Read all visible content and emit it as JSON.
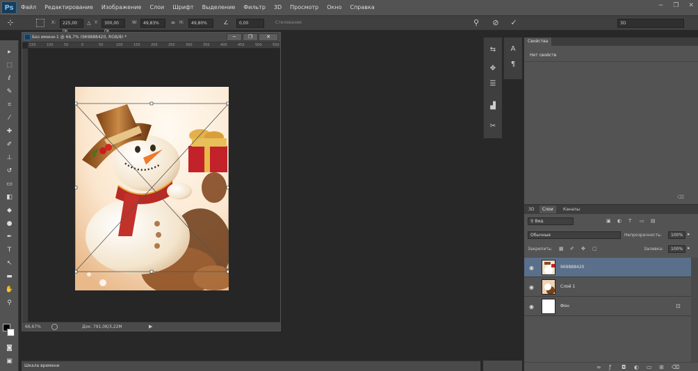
{
  "app": {
    "logo": "Ps",
    "win_minimize": "−",
    "win_restore": "❐",
    "win_close": "✕"
  },
  "menu": [
    "Файл",
    "Редактирование",
    "Изображение",
    "Слои",
    "Шрифт",
    "Выделение",
    "Фильтр",
    "3D",
    "Просмотр",
    "Окно",
    "Справка"
  ],
  "options": {
    "x_label": "X:",
    "x_value": "225,00 пк",
    "y_label": "Y:",
    "y_value": "300,00 пк",
    "w_label": "W:",
    "w_value": "49,83%",
    "h_label": "H:",
    "h_value": "49,80%",
    "angle_value": "0,00",
    "interp_label": "Стилевание",
    "workspace": "3D",
    "cancel_icon": "cancel-icon",
    "commit_icon": "checkmark-icon"
  },
  "document": {
    "title": "Без имени-1 @ 66,7% (969888420, RGB/8) *",
    "zoom": "66,67%",
    "doc_info": "Док: 791,0K/3,22M",
    "ruler_ticks": [
      "150",
      "100",
      "50",
      "0",
      "50",
      "100",
      "150",
      "200",
      "250",
      "300",
      "350",
      "400",
      "450",
      "500",
      "550",
      "600"
    ],
    "image_desc_name": "snowman-image"
  },
  "properties": {
    "tab": "Свойства",
    "message": "Нет свойств"
  },
  "layers": {
    "tabs": [
      "3D",
      "Слои",
      "Каналы"
    ],
    "filter_kind": "Вид",
    "blend_mode": "Обычные",
    "opacity_label": "Непрозрачность:",
    "opacity_value": "100%",
    "lock_label": "Закрепить:",
    "fill_label": "Заливка:",
    "fill_value": "100%",
    "items": [
      {
        "name": "969888420",
        "selected": true
      },
      {
        "name": "Слой 1",
        "selected": false
      },
      {
        "name": "Фон",
        "selected": false,
        "locked": true
      }
    ]
  },
  "timeline": {
    "label": "Шкала времени"
  },
  "colors": {
    "accent": "#5a6f8a",
    "panel": "#535353",
    "workspace": "#282828"
  }
}
